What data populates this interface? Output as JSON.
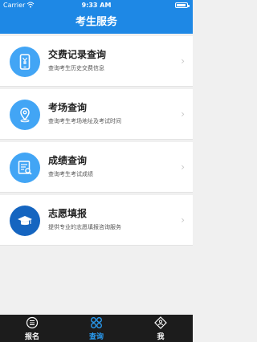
{
  "status_bar": {
    "carrier": "Carrier",
    "time": "9:33 AM"
  },
  "nav": {
    "title": "考生服务"
  },
  "items": [
    {
      "title": "交费记录查询",
      "subtitle": "查询考生历史交费信息",
      "icon": "phone-yuan-icon"
    },
    {
      "title": "考场查询",
      "subtitle": "查询考生考场地址及考试时间",
      "icon": "location-pin-icon"
    },
    {
      "title": "成绩查询",
      "subtitle": "查询考生考试成绩",
      "icon": "document-search-icon"
    },
    {
      "title": "志愿填报",
      "subtitle": "提供专业的志愿填报咨询服务",
      "icon": "graduation-cap-icon"
    }
  ],
  "tabs": [
    {
      "label": "报名",
      "icon": "list-circle-icon",
      "active": false
    },
    {
      "label": "查询",
      "icon": "grid-icon",
      "active": true
    },
    {
      "label": "我",
      "icon": "diamond-user-icon",
      "active": false
    }
  ],
  "colors": {
    "primary": "#1e88e5",
    "icon_bg": "#42a5f5",
    "tab_bar": "#1c1c1c",
    "tab_active": "#2a9df4"
  }
}
